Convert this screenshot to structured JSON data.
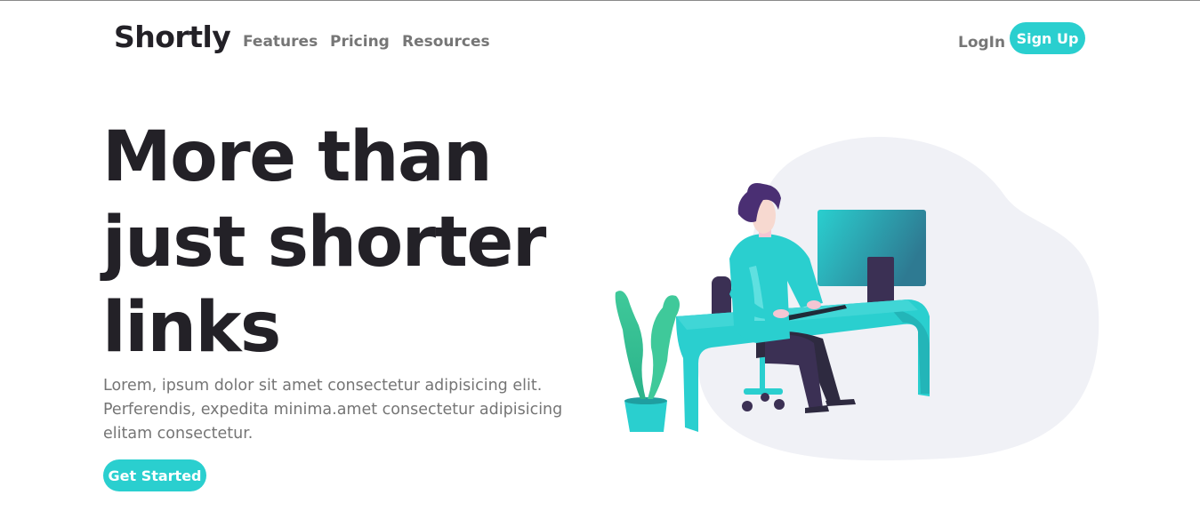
{
  "brand": {
    "name": "Shortly"
  },
  "nav": {
    "links": [
      {
        "label": "Features"
      },
      {
        "label": "Pricing"
      },
      {
        "label": "Resources"
      }
    ],
    "login_label": "LogIn",
    "signup_label": "Sign Up"
  },
  "hero": {
    "title_lines": [
      "More than",
      "just shorter",
      "links"
    ],
    "description_lines": [
      "Lorem, ipsum dolor sit amet consectetur adipisicing elit.",
      "Perferendis, expedita minima.amet consectetur adipisicing",
      "elitam consectetur."
    ],
    "cta_label": "Get Started"
  },
  "colors": {
    "accent": "#2acfcf",
    "heading": "#232127",
    "muted": "#767676",
    "blob": "#f0f1f6"
  },
  "illustration": {
    "icon": "person-working-at-desk-illustration"
  }
}
